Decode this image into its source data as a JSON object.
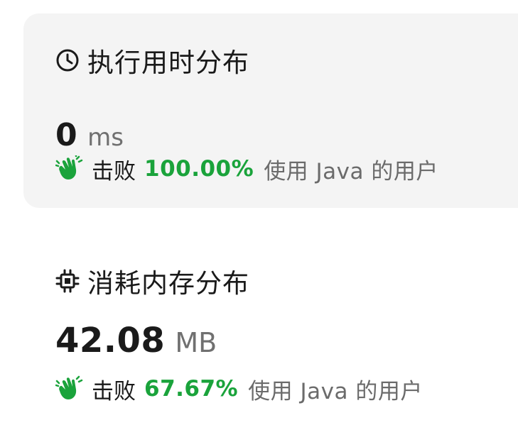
{
  "runtime": {
    "icon": "clock-icon",
    "title": "执行用时分布",
    "value": "0",
    "unit": "ms",
    "beat_label": "击败",
    "beat_percent": "100.00%",
    "beat_suffix": "使用 Java 的用户",
    "beat_icon": "clapping-hands-icon"
  },
  "memory": {
    "icon": "chip-icon",
    "title": "消耗内存分布",
    "value": "42.08",
    "unit": "MB",
    "beat_label": "击败",
    "beat_percent": "67.67%",
    "beat_suffix": "使用 Java 的用户",
    "beat_icon": "clapping-hands-icon"
  },
  "colors": {
    "card_background": "#f4f4f4",
    "accent_green": "#1aa33b",
    "text_primary": "#1a1a1a",
    "text_secondary": "#707070"
  }
}
